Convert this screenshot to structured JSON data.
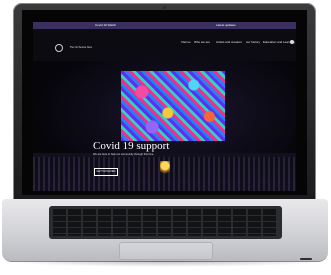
{
  "colors": {
    "topbar": "#3a2f5e",
    "header": "#0c0b12",
    "hero_bg": "#06050a",
    "laptop_lid": "#1b1b1d",
    "laptop_base": "#cfd0d4"
  },
  "topbar": {
    "left_text": "Covid 19 Watch",
    "right_text": "Latest updates"
  },
  "header": {
    "logo_text": "The Orchestra Now",
    "nav": [
      "Visit us",
      "Who we are",
      "Artists and creators",
      "our history",
      "Education and Learning"
    ],
    "icon": "search-icon"
  },
  "hero": {
    "title": "Covid 19 support",
    "subtitle": "We are here to help our community through this time.",
    "cta": "GET INVOLVED"
  }
}
